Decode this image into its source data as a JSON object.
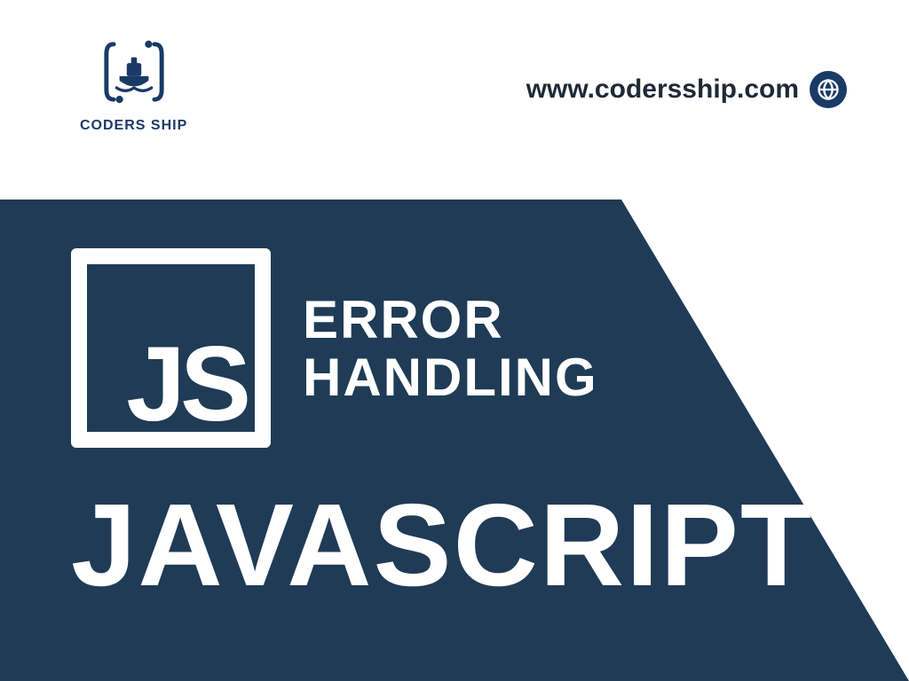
{
  "brand": {
    "name": "CODERS SHIP"
  },
  "url": {
    "text": "www.codersship.com"
  },
  "js_badge": {
    "letters": "JS"
  },
  "headline": {
    "line1": "ERROR",
    "line2": "HANDLING"
  },
  "title": "JAVASCRIPT",
  "colors": {
    "brand_dark": "#1a3a66",
    "banner": "#1f3b56"
  }
}
